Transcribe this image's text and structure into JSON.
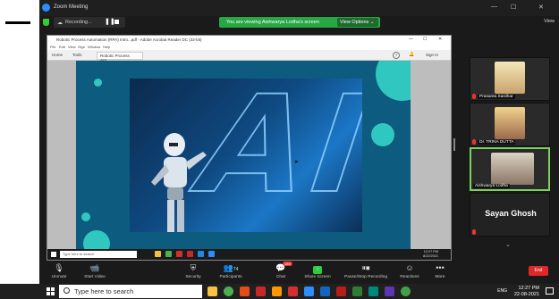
{
  "zoom": {
    "window_title": "Zoom Meeting",
    "recording_label": "Recording...",
    "viewing_banner": "You are viewing Aishwarya Lodha's screen",
    "view_options": "View Options ⌄",
    "view_button": "View"
  },
  "acrobat": {
    "title": "Robotic Process Automation (RPA) Intro...pdf - Adobe Acrobat Reader DC (32-bit)",
    "menu": [
      "File",
      "Edit",
      "View",
      "Sign",
      "Window",
      "Help"
    ],
    "tabs": [
      "Home",
      "Tools"
    ],
    "doc_tab": "Robotic Process Aut...",
    "sign_in": "Sign In",
    "slide_text": "AI"
  },
  "inner_taskbar": {
    "search_placeholder": "Type here to search",
    "time": "12:27 PM",
    "date": "8/22/2021"
  },
  "participants": [
    {
      "name": "Prasanta Sardhar",
      "muted": true
    },
    {
      "name": "Dr. TRINA DUTTA",
      "muted": true
    },
    {
      "name": "Aishwarya Lodha",
      "muted": false,
      "active": true
    },
    {
      "name": "Sayan Ghosh",
      "muted": true,
      "text_only": true
    }
  ],
  "controls": {
    "unmute": "Unmute",
    "start_video": "Start Video",
    "security": "Security",
    "participants": "Participants",
    "participants_count": "74",
    "chat": "Chat",
    "chat_badge": "189",
    "share_screen": "Share Screen",
    "recording": "Pause/Stop Recording",
    "reactions": "Reactions",
    "more": "More",
    "end": "End"
  },
  "taskbar": {
    "search_placeholder": "Type here to search",
    "lang": "ENG",
    "time": "12:27 PM",
    "date": "22-08-2021"
  },
  "colors": {
    "banner_green": "#28a745",
    "end_red": "#e02828",
    "slide_teal": "#30c7c0",
    "slide_blue": "#0d5b7e"
  }
}
